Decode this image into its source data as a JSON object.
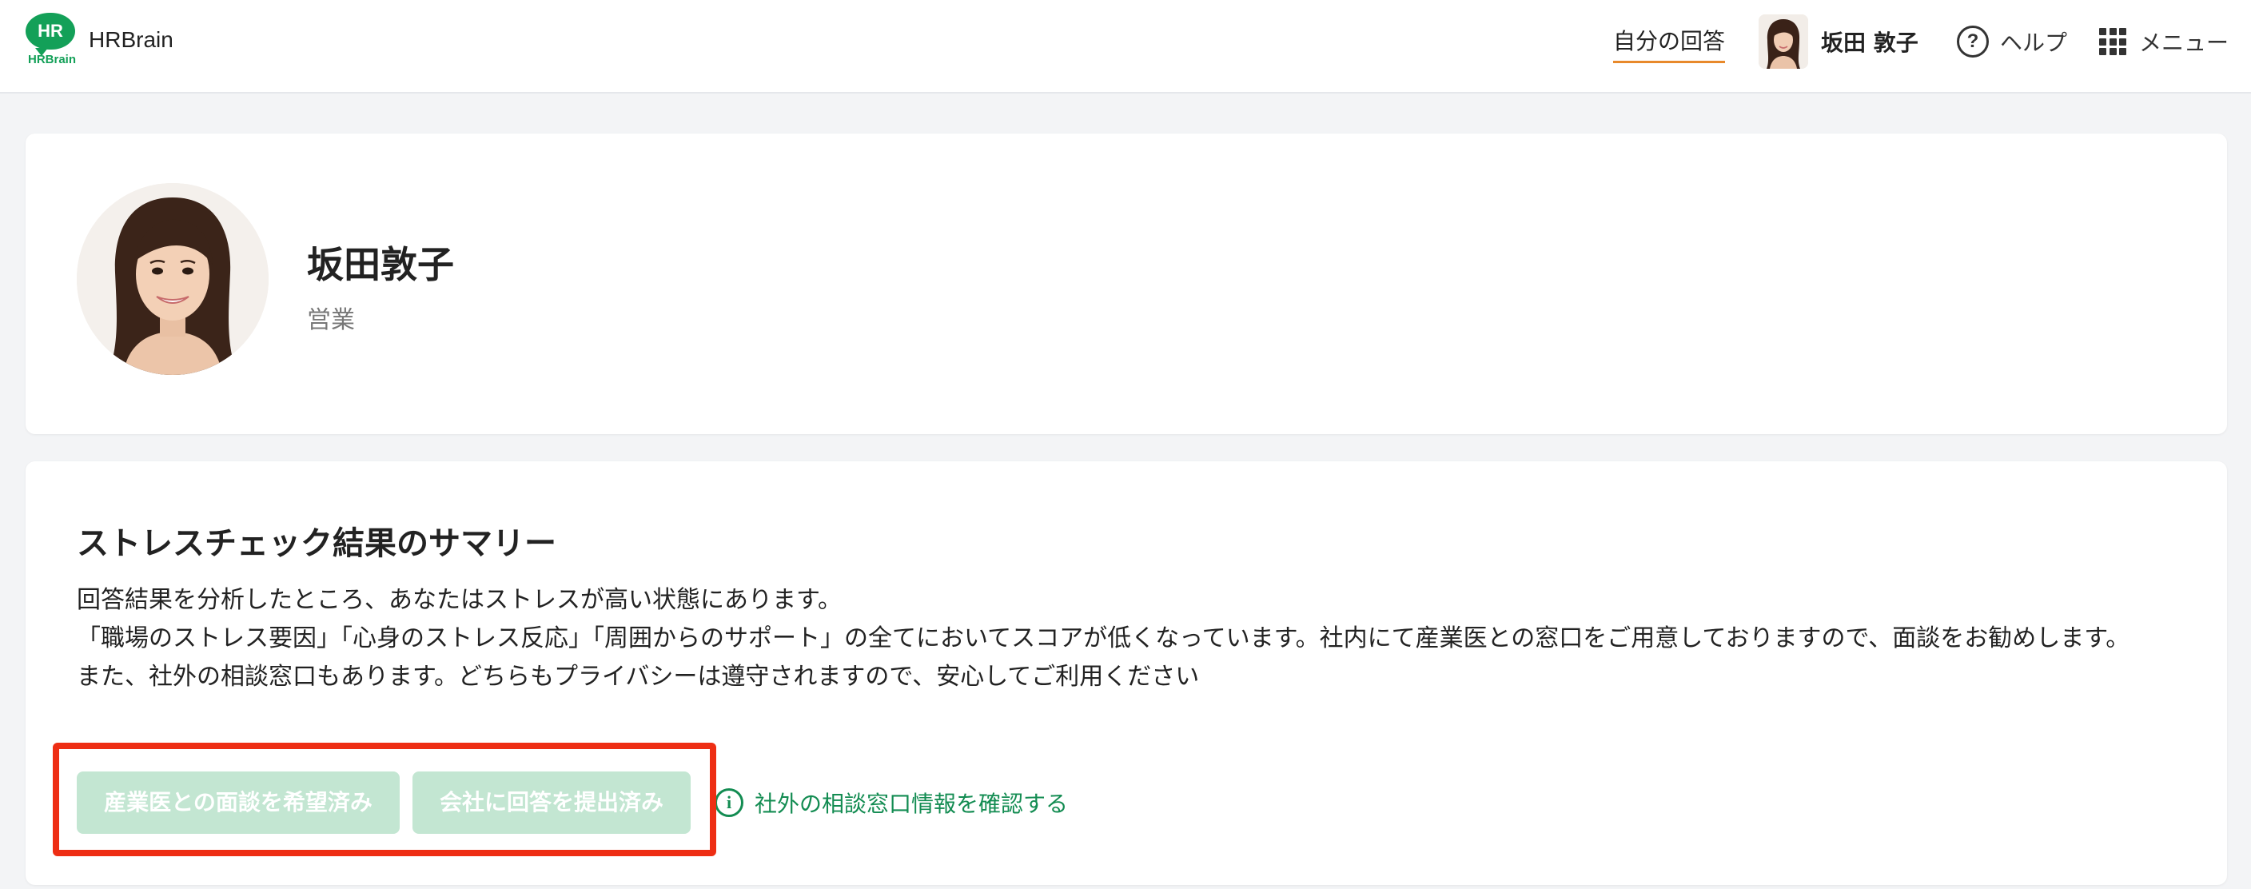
{
  "header": {
    "logo_text": "HR",
    "logo_sub": "HRBrain",
    "brand": "HRBrain",
    "nav_answers": "自分の回答",
    "user_name": "坂田 敦子",
    "help_label": "ヘルプ",
    "help_icon_glyph": "?",
    "menu_label": "メニュー"
  },
  "profile": {
    "name": "坂田敦子",
    "department": "営業"
  },
  "summary": {
    "title": "ストレスチェック結果のサマリー",
    "paragraphs": [
      "回答結果を分析したところ、あなたはストレスが高い状態にあります。",
      "「職場のストレス要因」「心身のストレス反応」「周囲からのサポート」の全てにおいてスコアが低くなっています。社内にて産業医との窓口をご用意しておりますので、面談をお勧めします。",
      "また、社外の相談窓口もあります。どちらもプライバシーは遵守されますので、安心してご利用ください"
    ],
    "doctor_button": "産業医との面談を希望済み",
    "submit_button": "会社に回答を提出済み",
    "external_link": "社外の相談窓口情報を確認する",
    "info_icon_glyph": "i"
  },
  "colors": {
    "brand_green": "#13a058",
    "link_green": "#138c52",
    "disabled_button": "#c3e6d2",
    "highlight_red": "#ee2e14",
    "nav_underline": "#e8892b"
  },
  "icons": [
    "hrbrain-logo-icon",
    "avatar-icon",
    "help-icon",
    "grid-menu-icon",
    "info-icon"
  ]
}
